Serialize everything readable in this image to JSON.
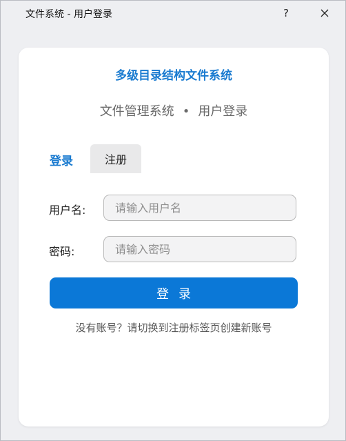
{
  "window": {
    "title": "文件系统 - 用户登录",
    "help_label": "?",
    "close_icon": "close-icon"
  },
  "app": {
    "title": "多级目录结构文件系统",
    "subtitle_left": "文件管理系统",
    "subtitle_sep": "•",
    "subtitle_right": "用户登录"
  },
  "tabs": [
    {
      "label": "登录",
      "active": true
    },
    {
      "label": "注册",
      "active": false
    }
  ],
  "form": {
    "username_label": "用户名:",
    "username_placeholder": "请输入用户名",
    "username_value": "",
    "password_label": "密码:",
    "password_placeholder": "请输入密码",
    "password_value": "",
    "submit_label": "登录"
  },
  "hint": "没有账号？请切换到注册标签页创建新账号",
  "colors": {
    "accent": "#1a7bd0",
    "button": "#0b78d7",
    "background": "#eeeff2",
    "card": "#ffffff"
  }
}
